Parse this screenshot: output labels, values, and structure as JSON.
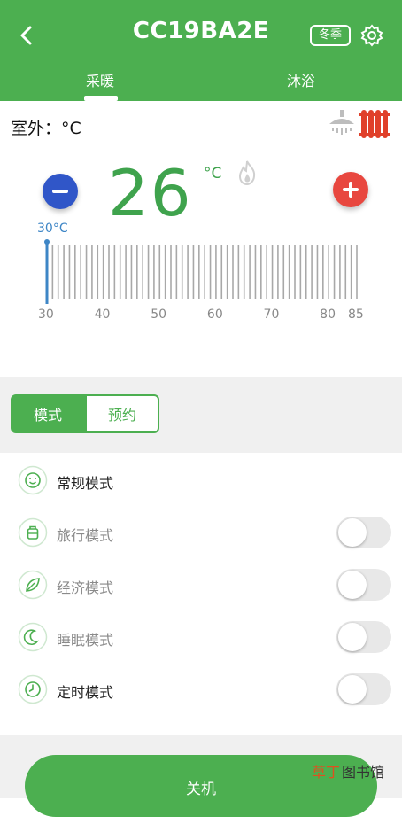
{
  "header": {
    "title": "CC19BA2E",
    "season_badge": "冬季",
    "tabs": [
      {
        "label": "采暖",
        "active": true
      },
      {
        "label": "沐浴",
        "active": false
      }
    ]
  },
  "outdoor": {
    "label": "室外：°C"
  },
  "temperature": {
    "value": "26",
    "unit": "°C",
    "min_marker_label": "30°C",
    "scale_labels": [
      "30",
      "40",
      "50",
      "60",
      "70",
      "80",
      "85"
    ]
  },
  "segments": {
    "mode": "模式",
    "schedule": "预约"
  },
  "modes": [
    {
      "label": "常规模式",
      "icon": "smile-icon",
      "active": true
    },
    {
      "label": "旅行模式",
      "icon": "luggage-icon",
      "active": false
    },
    {
      "label": "经济模式",
      "icon": "leaf-icon",
      "active": false
    },
    {
      "label": "睡眠模式",
      "icon": "moon-icon",
      "active": false
    },
    {
      "label": "定时模式",
      "icon": "clock-icon",
      "active": false
    }
  ],
  "power_button": "关机",
  "watermark": {
    "part1": "草丁",
    "part2": "图书馆"
  },
  "colors": {
    "primary": "#4caf50",
    "minus": "#3056c8",
    "plus": "#e8473f",
    "scale_marker": "#3e86c6"
  }
}
